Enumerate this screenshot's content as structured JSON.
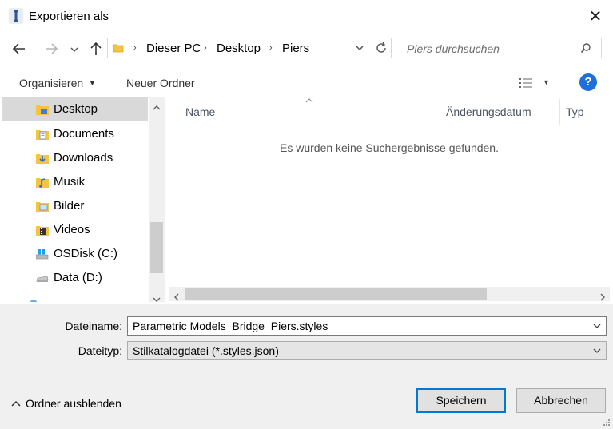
{
  "window": {
    "title": "Exportieren als"
  },
  "address": {
    "segments": [
      "Dieser PC",
      "Desktop",
      "Piers"
    ]
  },
  "search": {
    "placeholder": "Piers durchsuchen"
  },
  "toolbar": {
    "organize_label": "Organisieren",
    "new_folder_label": "Neuer Ordner",
    "help_label": "?"
  },
  "sidebar": {
    "items": [
      {
        "label": "Desktop",
        "icon": "desktop-folder-icon",
        "selected": true
      },
      {
        "label": "Documents",
        "icon": "documents-folder-icon"
      },
      {
        "label": "Downloads",
        "icon": "downloads-folder-icon"
      },
      {
        "label": "Musik",
        "icon": "music-folder-icon"
      },
      {
        "label": "Bilder",
        "icon": "pictures-folder-icon"
      },
      {
        "label": "Videos",
        "icon": "videos-folder-icon"
      },
      {
        "label": "OSDisk (C:)",
        "icon": "windows-drive-icon"
      },
      {
        "label": "Data (D:)",
        "icon": "drive-icon"
      }
    ]
  },
  "file_list": {
    "columns": [
      "Name",
      "Änderungsdatum",
      "Typ"
    ],
    "empty_message": "Es wurden keine Suchergebnisse gefunden."
  },
  "form": {
    "filename_label": "Dateiname:",
    "filename_value": "Parametric Models_Bridge_Piers.styles",
    "filetype_label": "Dateityp:",
    "filetype_value": "Stilkatalogdatei (*.styles.json)"
  },
  "footer": {
    "hide_folders_label": "Ordner ausblenden",
    "save_label": "Speichern",
    "cancel_label": "Abbrechen"
  },
  "colors": {
    "accent": "#0078d7",
    "selection": "#d9d9d9",
    "folder": "#f5c542",
    "help": "#1e6fd9"
  }
}
